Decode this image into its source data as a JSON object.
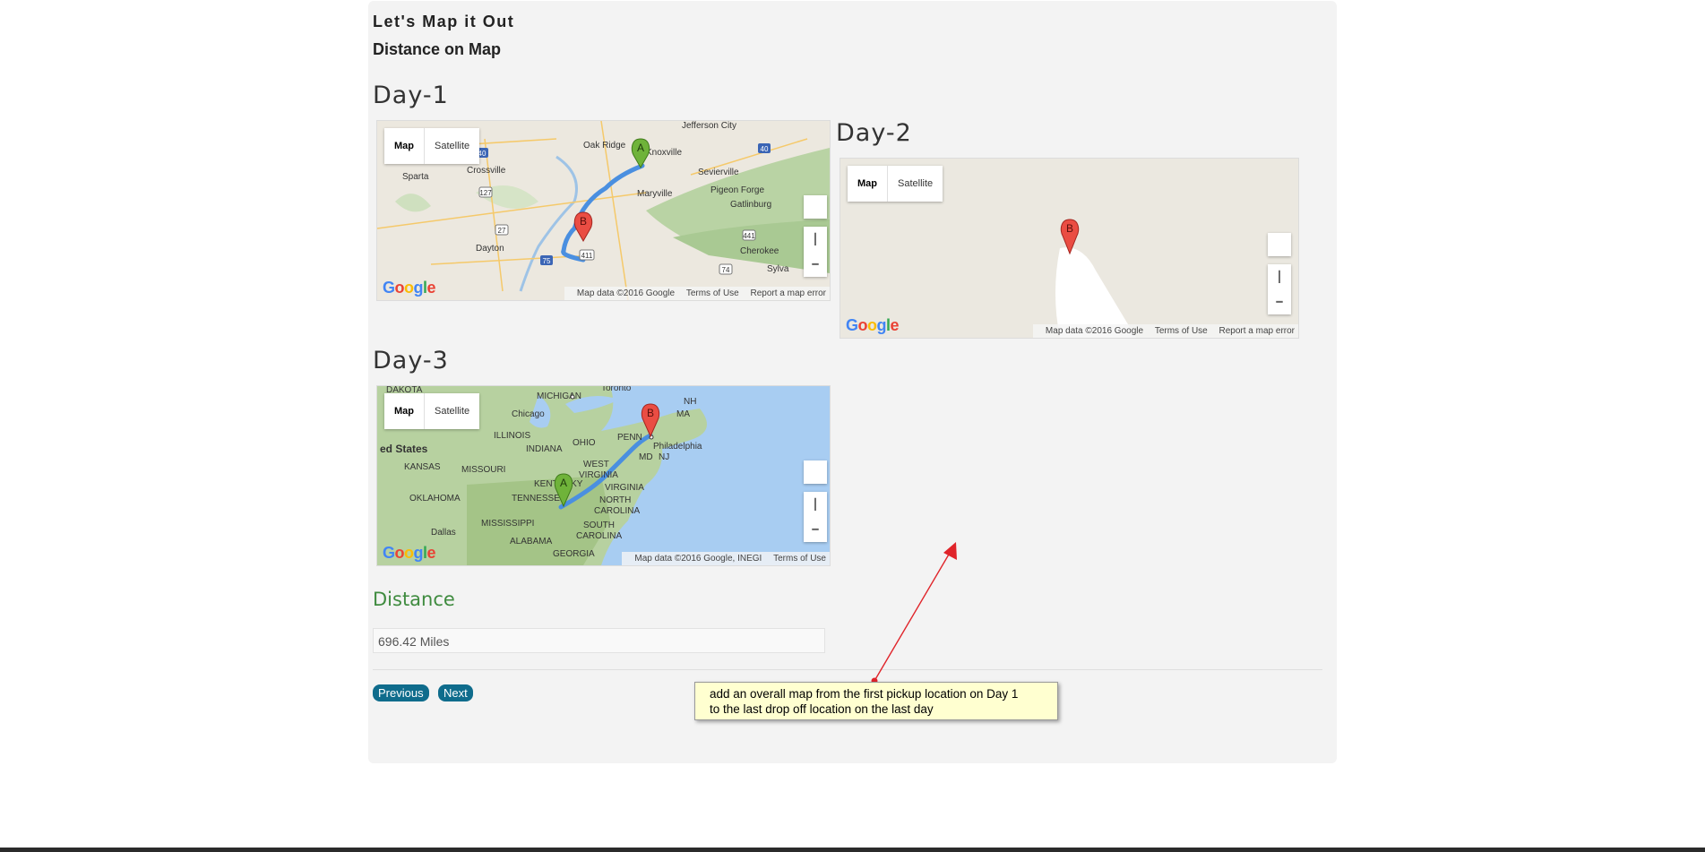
{
  "page": {
    "title": "Let's Map it Out",
    "subtitle": "Distance on Map"
  },
  "maps": [
    {
      "day_label": "Day-1",
      "map_type": {
        "map_label": "Map",
        "satellite_label": "Satellite"
      },
      "place_labels": [
        "Oak Ridge",
        "Knoxville",
        "Jefferson City",
        "Sevierville",
        "Maryville",
        "Pigeon Forge",
        "Gatlinburg",
        "Crossville",
        "Sparta",
        "Dayton",
        "Cherokee",
        "Sylva"
      ],
      "road_shields": [
        "40",
        "40",
        "127",
        "27",
        "75",
        "441",
        "74",
        "411"
      ],
      "markers": [
        "A",
        "B"
      ],
      "attribution": {
        "data": "Map data ©2016 Google",
        "terms": "Terms of Use",
        "report": "Report a map error"
      }
    },
    {
      "day_label": "Day-2",
      "map_type": {
        "map_label": "Map",
        "satellite_label": "Satellite"
      },
      "markers": [
        "B"
      ],
      "attribution": {
        "data": "Map data ©2016 Google",
        "terms": "Terms of Use",
        "report": "Report a map error"
      }
    },
    {
      "day_label": "Day-3",
      "map_type": {
        "map_label": "Map",
        "satellite_label": "Satellite"
      },
      "place_labels": [
        "DAKOTA",
        "MICHIGAN",
        "Toronto",
        "NH",
        "MA",
        "Chicago",
        "ILLINOIS",
        "INDIANA",
        "OHIO",
        "PENN",
        "Philadelphia",
        "ed States",
        "MD",
        "NJ",
        "KANSAS",
        "MISSOURI",
        "WEST",
        "VIRGINIA",
        "KENTUCKY",
        "VIRGINIA",
        "OKLAHOMA",
        "TENNESSEE",
        "NORTH",
        "CAROLINA",
        "Dallas",
        "MISSISSIPPI",
        "ALABAMA",
        "SOUTH",
        "CAROLINA",
        "GEORGIA"
      ],
      "markers": [
        "A",
        "B"
      ],
      "attribution": {
        "data": "Map data ©2016 Google, INEGI",
        "terms": "Terms of Use"
      }
    }
  ],
  "google_logo": {
    "letters": [
      "G",
      "o",
      "o",
      "g",
      "l",
      "e"
    ]
  },
  "distance": {
    "heading": "Distance",
    "value": "696.42 Miles"
  },
  "nav": {
    "previous_label": "Previous",
    "next_label": "Next"
  },
  "annotation": {
    "text_line1": "add an overall map from the first pickup location on Day 1",
    "text_line2": "to the last drop off location on the last day"
  },
  "colors": {
    "panel_bg": "#f3f3f3",
    "distance_green": "#3f8b3f",
    "button_blue": "#0f6c8c",
    "note_bg": "#ffffd0",
    "arrow_red": "#e0242a"
  }
}
